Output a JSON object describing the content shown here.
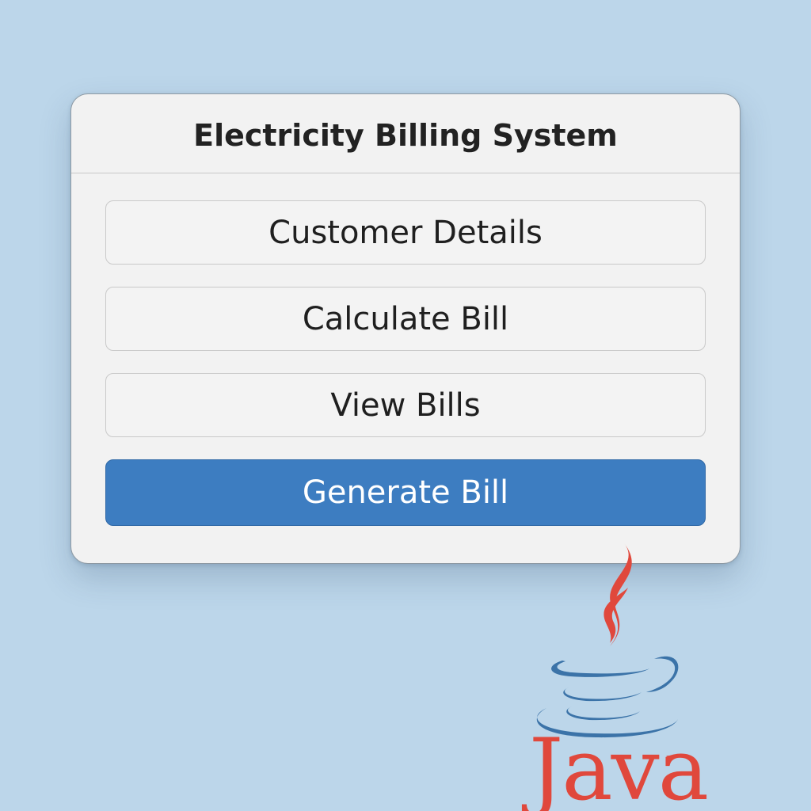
{
  "window": {
    "title": "Electricity Billing System"
  },
  "menu": {
    "items": [
      {
        "label": "Customer Details"
      },
      {
        "label": "Calculate Bill"
      },
      {
        "label": "View Bills"
      },
      {
        "label": "Generate Bill"
      }
    ]
  },
  "logo": {
    "icon": "java-coffee-cup-icon",
    "word": "Java",
    "trademark": "™"
  },
  "colors": {
    "background": "#bcd6ea",
    "primary_button": "#3d7dc1",
    "java_red": "#e0483c",
    "java_blue": "#3b73a8"
  }
}
